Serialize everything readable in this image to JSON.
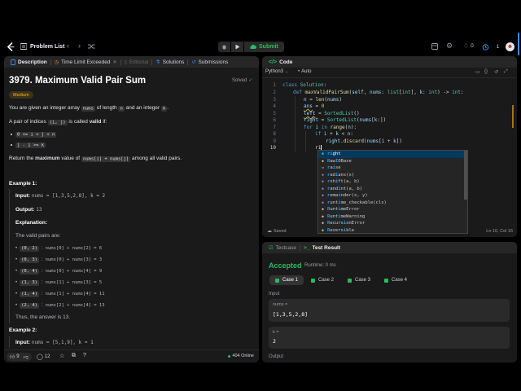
{
  "header": {
    "problem_list": "Problem List",
    "submit": "Submit",
    "streak": "0",
    "counter_badge": "1"
  },
  "description": {
    "tabs": [
      "Description",
      "Time Limit Exceeded",
      "Editorial",
      "Solutions",
      "Submissions"
    ],
    "title": "3979. Maximum Valid Pair Sum",
    "status": "Solved",
    "difficulty": "Medium",
    "para1_a": "You are given an integer array",
    "para1_nums": "nums",
    "para1_b": "of length",
    "para1_n": "n",
    "para1_c": "and an integer",
    "para1_k": "k",
    "para1_d": ".",
    "para2_a": "A pair of indices",
    "para2_chip": "(i, j)",
    "para2_b": "is called",
    "para2_valid": "valid",
    "para2_c": "if:",
    "cond1": "0 <= i < j < n",
    "cond2": "j - i >= k",
    "para3_a": "Return the",
    "para3_max": "maximum",
    "para3_b": "value of",
    "para3_chip": "nums[i] + nums[j]",
    "para3_c": "among all valid pairs.",
    "ex1_title": "Example 1:",
    "ex1_input_label": "Input:",
    "ex1_input": "nums = [1,3,5,2,8], k = 2",
    "ex1_output_label": "Output:",
    "ex1_output": "13",
    "ex1_expl_label": "Explanation:",
    "ex1_expl_text": "The valid pairs are:",
    "ex1_pairs": [
      {
        "pair": "(0, 2)",
        "expr": "nums[0] + nums[2] = 6"
      },
      {
        "pair": "(0, 3)",
        "expr": "nums[0] + nums[3] = 3"
      },
      {
        "pair": "(0, 4)",
        "expr": "nums[0] + nums[4] = 9"
      },
      {
        "pair": "(1, 3)",
        "expr": "nums[1] + nums[3] = 5"
      },
      {
        "pair": "(1, 4)",
        "expr": "nums[1] + nums[4] = 11"
      },
      {
        "pair": "(2, 4)",
        "expr": "nums[2] + nums[4] = 13"
      }
    ],
    "ex1_thus": "Thus, the answer is 13.",
    "ex2_title": "Example 2:",
    "ex2_input_label": "Input:",
    "ex2_input": "nums = [5,1,9], k = 1",
    "likes": "9",
    "comments": "12",
    "online": "404 Online"
  },
  "code": {
    "title": "Code",
    "language": "Python3",
    "auto": "Auto",
    "saved": "Saved",
    "cursor_pos": "Ln 10, Col 16",
    "line_numbers": [
      "1",
      "2",
      "3",
      "4",
      "5",
      "6",
      "7",
      "8",
      "9",
      "10"
    ],
    "typed": "ri",
    "autocomplete": [
      {
        "pre": "ri",
        "rest": "ght"
      },
      {
        "pre": "R",
        "mid": "aw",
        "pre2": "I",
        "rest": "OBase"
      },
      {
        "pre": "r",
        "mid": "a",
        "pre2": "i",
        "rest": "se"
      },
      {
        "pre": "r",
        "mid": "ad",
        "pre2": "i",
        "rest": "ans(x)"
      },
      {
        "pre": "r",
        "mid": "sh",
        "pre2": "i",
        "rest": "ft(a, b)"
      },
      {
        "pre": "r",
        "mid": "and",
        "pre2": "i",
        "rest": "nt(a, b)"
      },
      {
        "pre": "r",
        "mid": "ema",
        "pre2": "i",
        "rest": "nder(x, y)"
      },
      {
        "pre": "r",
        "mid": "unt",
        "pre2": "i",
        "rest": "me_checkable(cls)"
      },
      {
        "pre": "R",
        "mid": "unt",
        "pre2": "i",
        "rest": "meError"
      },
      {
        "pre": "R",
        "mid": "unt",
        "pre2": "i",
        "rest": "meWarning"
      },
      {
        "pre": "R",
        "mid": "ecurs",
        "pre2": "i",
        "rest": "onError"
      },
      {
        "pre": "R",
        "mid": "evers",
        "pre2": "i",
        "rest": "ble"
      }
    ]
  },
  "testresult": {
    "tab_testcase": "Testcase",
    "tab_result": "Test Result",
    "accepted": "Accepted",
    "runtime": "Runtime: 0 ms",
    "cases": [
      "Case 1",
      "Case 2",
      "Case 3",
      "Case 4"
    ],
    "input_label": "Input",
    "var1_name": "nums =",
    "var1_value": "[1,3,5,2,8]",
    "var2_name": "k =",
    "var2_value": "2",
    "output_label": "Output"
  },
  "colors": {
    "accent_green": "#2cbb5d",
    "medium": "#ffb800",
    "blue": "#3c8cff"
  }
}
